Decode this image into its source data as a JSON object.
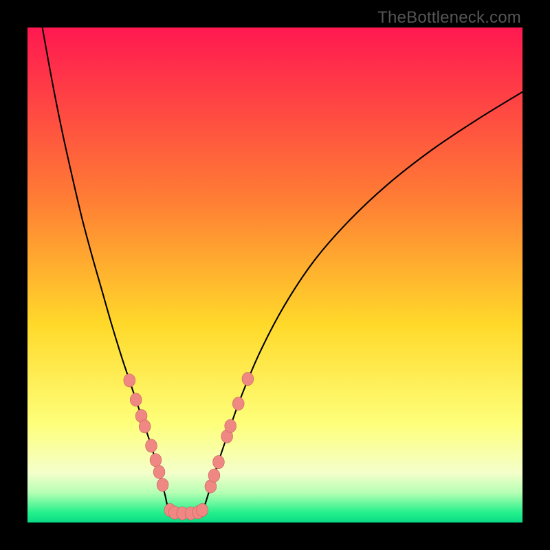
{
  "watermark": "TheBottleneck.com",
  "colors": {
    "frame": "#000000",
    "curve": "#000000",
    "marker_fill": "#ef8783",
    "marker_stroke": "#c5605c"
  },
  "chart_data": {
    "type": "line",
    "title": "",
    "xlabel": "",
    "ylabel": "",
    "xlim": [
      0,
      100
    ],
    "ylim": [
      100,
      0
    ],
    "gradient_stops": [
      {
        "offset": 0,
        "color": "#ff1850"
      },
      {
        "offset": 35,
        "color": "#ff7e34"
      },
      {
        "offset": 60,
        "color": "#ffd92a"
      },
      {
        "offset": 80,
        "color": "#feff7a"
      },
      {
        "offset": 90,
        "color": "#f4ffcb"
      },
      {
        "offset": 94,
        "color": "#b5ffb3"
      },
      {
        "offset": 98,
        "color": "#25f08c"
      },
      {
        "offset": 100,
        "color": "#09db86"
      }
    ],
    "series": [
      {
        "name": "left-branch",
        "x": [
          3,
          5,
          7,
          9,
          11,
          13,
          15,
          17,
          19,
          20.5,
          22,
          23.5,
          25,
          26,
          27,
          27.8,
          28.4
        ],
        "y": [
          0,
          11,
          21,
          30,
          38.5,
          46,
          53,
          60,
          66.5,
          71,
          75.5,
          80,
          84.5,
          88,
          91.5,
          94.5,
          97
        ]
      },
      {
        "name": "valley-floor",
        "x": [
          28.4,
          29.3,
          30.5,
          32,
          33.5,
          34.7,
          35.6
        ],
        "y": [
          97,
          97.9,
          98.1,
          98.15,
          98.1,
          97.9,
          97
        ]
      },
      {
        "name": "right-branch",
        "x": [
          35.6,
          36.6,
          38,
          40,
          43,
          47,
          52,
          58,
          65,
          73,
          82,
          91,
          100
        ],
        "y": [
          97,
          94,
          89.5,
          83.5,
          75,
          65.5,
          56,
          47,
          39,
          31.5,
          24.5,
          18.5,
          13
        ]
      }
    ],
    "markers": [
      {
        "x": 20.6,
        "y": 71.3
      },
      {
        "x": 21.9,
        "y": 75.2
      },
      {
        "x": 23.0,
        "y": 78.5
      },
      {
        "x": 23.7,
        "y": 80.6
      },
      {
        "x": 25.0,
        "y": 84.5
      },
      {
        "x": 25.9,
        "y": 87.4
      },
      {
        "x": 26.6,
        "y": 89.8
      },
      {
        "x": 27.3,
        "y": 92.4
      },
      {
        "x": 28.8,
        "y": 97.5
      },
      {
        "x": 29.7,
        "y": 98.0
      },
      {
        "x": 31.3,
        "y": 98.15
      },
      {
        "x": 33.0,
        "y": 98.15
      },
      {
        "x": 34.5,
        "y": 97.95
      },
      {
        "x": 35.3,
        "y": 97.5
      },
      {
        "x": 37.0,
        "y": 92.7
      },
      {
        "x": 37.7,
        "y": 90.5
      },
      {
        "x": 38.6,
        "y": 87.8
      },
      {
        "x": 40.3,
        "y": 82.6
      },
      {
        "x": 41.0,
        "y": 80.5
      },
      {
        "x": 42.6,
        "y": 76.0
      },
      {
        "x": 44.5,
        "y": 71.0
      }
    ]
  }
}
